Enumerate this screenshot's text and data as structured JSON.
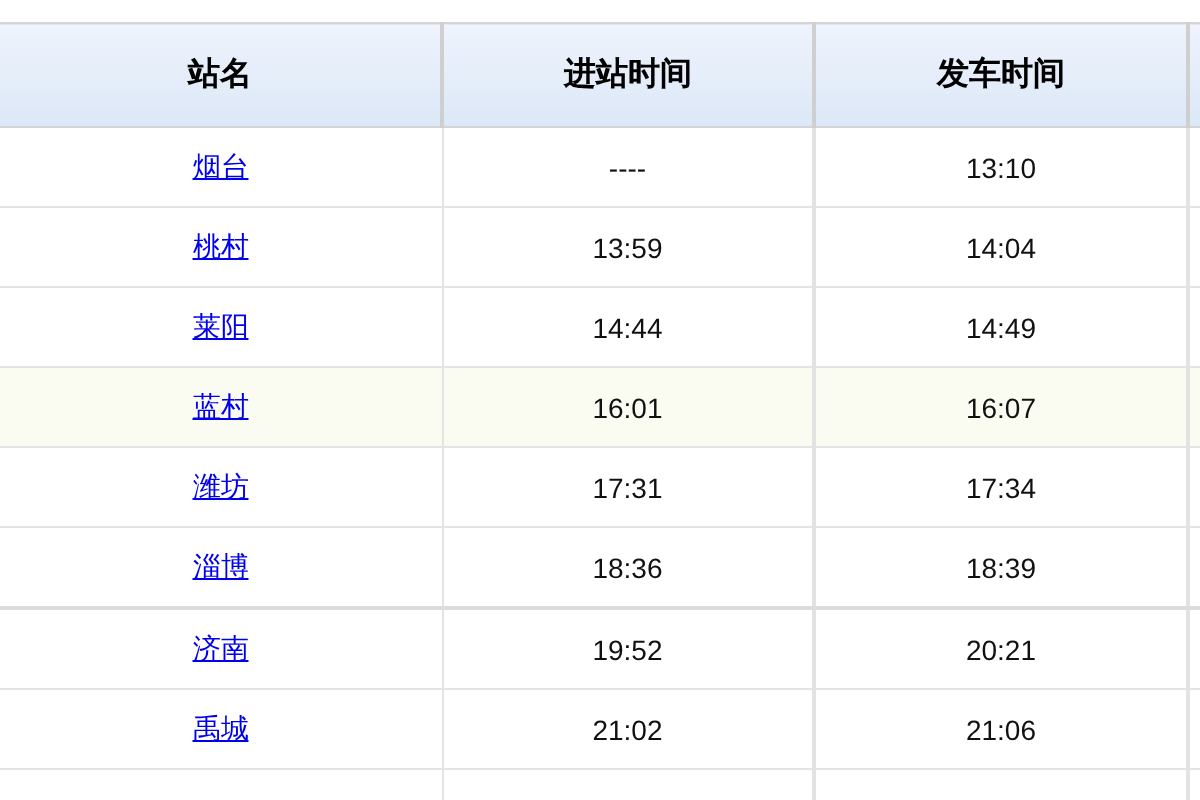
{
  "table": {
    "columns": [
      "站名",
      "进站时间",
      "发车时间"
    ],
    "rows": [
      {
        "station": "烟台",
        "arrival": "----",
        "departure": "13:10",
        "highlighted": false
      },
      {
        "station": "桃村",
        "arrival": "13:59",
        "departure": "14:04",
        "highlighted": false
      },
      {
        "station": "莱阳",
        "arrival": "14:44",
        "departure": "14:49",
        "highlighted": false
      },
      {
        "station": "蓝村",
        "arrival": "16:01",
        "departure": "16:07",
        "highlighted": true
      },
      {
        "station": "潍坊",
        "arrival": "17:31",
        "departure": "17:34",
        "highlighted": false
      },
      {
        "station": "淄博",
        "arrival": "18:36",
        "departure": "18:39",
        "highlighted": false
      },
      {
        "station": "济南",
        "arrival": "19:52",
        "departure": "20:21",
        "highlighted": false
      },
      {
        "station": "禹城",
        "arrival": "21:02",
        "departure": "21:06",
        "highlighted": false
      }
    ]
  }
}
